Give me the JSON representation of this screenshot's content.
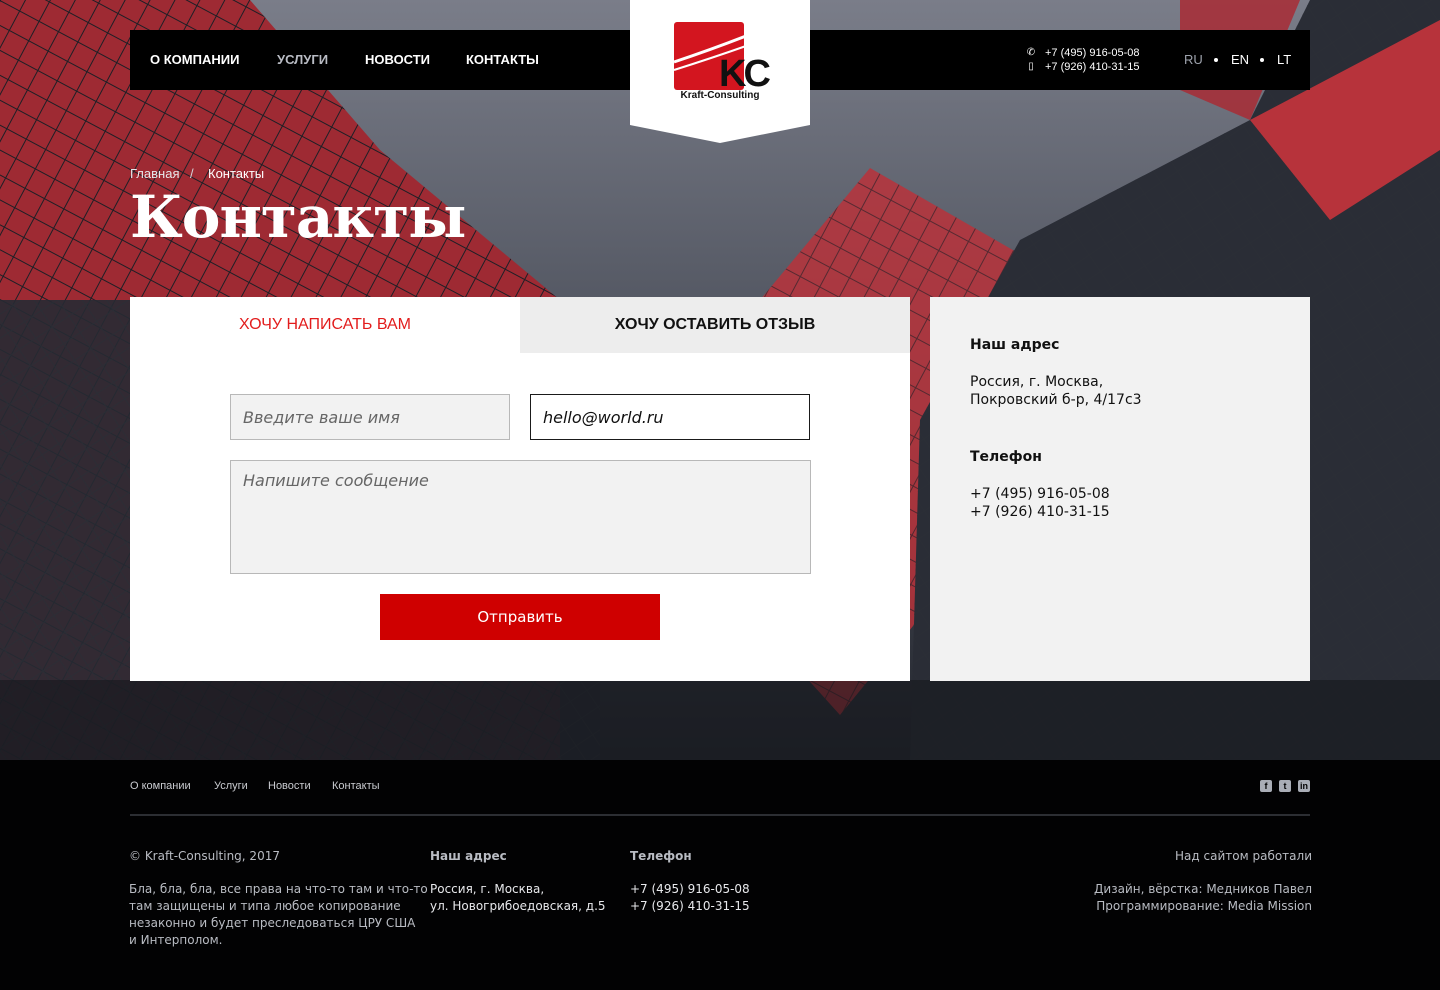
{
  "header": {
    "nav": [
      "О КОМПАНИИ",
      "УСЛУГИ",
      "НОВОСТИ",
      "КОНТАКТЫ"
    ],
    "logo_text": "Kraft-Consulting",
    "logo_letters": "KC",
    "phones": [
      "+7 (495) 916-05-08",
      "+7 (926) 410-31-15"
    ],
    "phone_icons": [
      "phone-icon",
      "mobile-icon"
    ],
    "languages": [
      "RU",
      "EN",
      "LT"
    ]
  },
  "breadcrumb": {
    "home": "Главная",
    "separator": "/",
    "current": "Контакты"
  },
  "page_title": "Контакты",
  "form": {
    "tab_write": "ХОЧУ НАПИСАТЬ ВАМ",
    "tab_review": "ХОЧУ ОСТАВИТЬ ОТЗЫВ",
    "name_placeholder": "Введите ваше имя",
    "email_value": "hello@world.ru",
    "message_placeholder": "Напишите сообщение",
    "submit": "Отправить"
  },
  "contact_info": {
    "address_label": "Наш адрес",
    "address_lines": [
      "Россия, г. Москва,",
      "Покровский б-р, 4/17с3"
    ],
    "phone_label": "Телефон",
    "phones": [
      "+7 (495) 916-05-08",
      "+7 (926) 410-31-15"
    ]
  },
  "footer": {
    "nav": [
      "О компании",
      "Услуги",
      "Новости",
      "Контакты"
    ],
    "social": [
      "facebook-icon",
      "twitter-icon",
      "linkedin-icon"
    ],
    "copyright": "© Kraft-Consulting, 2017",
    "legal": [
      "Бла, бла, бла, все права на что-то там и что-то",
      "там защищены и типа любое копирование",
      "незаконно и будет преследоваться ЦРУ США",
      "и Интерполом."
    ],
    "address_label": "Наш адрес",
    "address_lines": [
      "Россия, г. Москва,",
      "ул. Новогрибоедовская, д.5"
    ],
    "phone_label": "Телефон",
    "phones": [
      "+7 (495) 916-05-08",
      "+7 (926) 410-31-15"
    ],
    "credits_title": "Над сайтом работали",
    "credits": [
      "Дизайн, вёрстка: Медников Павел",
      "Программирование: Media Mission"
    ]
  },
  "colors": {
    "accent": "#cf0000",
    "tab_active": "#e21d1d",
    "hero_red": "#c7343c",
    "info_bg": "#f2f2f2"
  }
}
